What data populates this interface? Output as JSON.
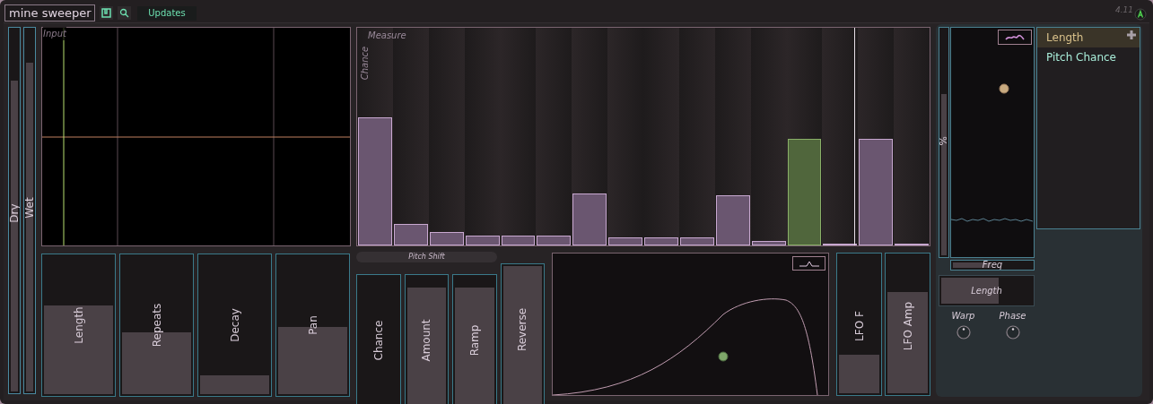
{
  "toolbar": {
    "preset": "mine sweeper",
    "updates_button": "Updates",
    "version": "4.11"
  },
  "mix": [
    {
      "label": "Dry",
      "level": 0.86
    },
    {
      "label": "Wet",
      "level": 0.91
    }
  ],
  "input_scope": {
    "title": "Input"
  },
  "delay_sliders": [
    {
      "label": "Length",
      "level": 0.65
    },
    {
      "label": "Repeats",
      "level": 0.46
    },
    {
      "label": "Decay",
      "level": 0.16
    },
    {
      "label": "Pan",
      "level": 0.5
    }
  ],
  "sequencer": {
    "title": "Measure",
    "axis_label": "Chance",
    "steps": [
      {
        "level": 0.59,
        "selected": false
      },
      {
        "level": 0.1,
        "selected": false
      },
      {
        "level": 0.06,
        "selected": false
      },
      {
        "level": 0.045,
        "selected": false
      },
      {
        "level": 0.045,
        "selected": false
      },
      {
        "level": 0.045,
        "selected": false
      },
      {
        "level": 0.24,
        "selected": false
      },
      {
        "level": 0.037,
        "selected": false
      },
      {
        "level": 0.037,
        "selected": false
      },
      {
        "level": 0.037,
        "selected": false
      },
      {
        "level": 0.23,
        "selected": false
      },
      {
        "level": 0.02,
        "selected": false
      },
      {
        "level": 0.49,
        "selected": true
      },
      {
        "level": 0.005,
        "selected": false
      },
      {
        "level": 0.49,
        "selected": false
      },
      {
        "level": 0.008,
        "selected": false
      }
    ]
  },
  "pitch_shift": {
    "title": "Pitch Shift",
    "sliders": [
      {
        "label": "Chance",
        "level": 0
      },
      {
        "label": "Amount",
        "level": 0.92
      },
      {
        "label": "Ramp",
        "level": 0.92
      },
      {
        "label": "Reverse",
        "level": 1.0
      }
    ]
  },
  "lfo_sliders": [
    {
      "label": "LFO F",
      "level": 0.3
    },
    {
      "label": "LFO Amp",
      "level": 0.74
    }
  ],
  "modulator": {
    "amount": {
      "label": "%",
      "level": 0.72
    },
    "freq": {
      "label": "Freq",
      "level": 0.5
    },
    "length": {
      "label": "Length",
      "level": 0.65
    },
    "knobs": [
      {
        "label": "Warp"
      },
      {
        "label": "Phase"
      }
    ]
  },
  "targets": [
    {
      "label": "Length",
      "selected": true
    },
    {
      "label": "Pitch Chance",
      "selected": false
    }
  ]
}
